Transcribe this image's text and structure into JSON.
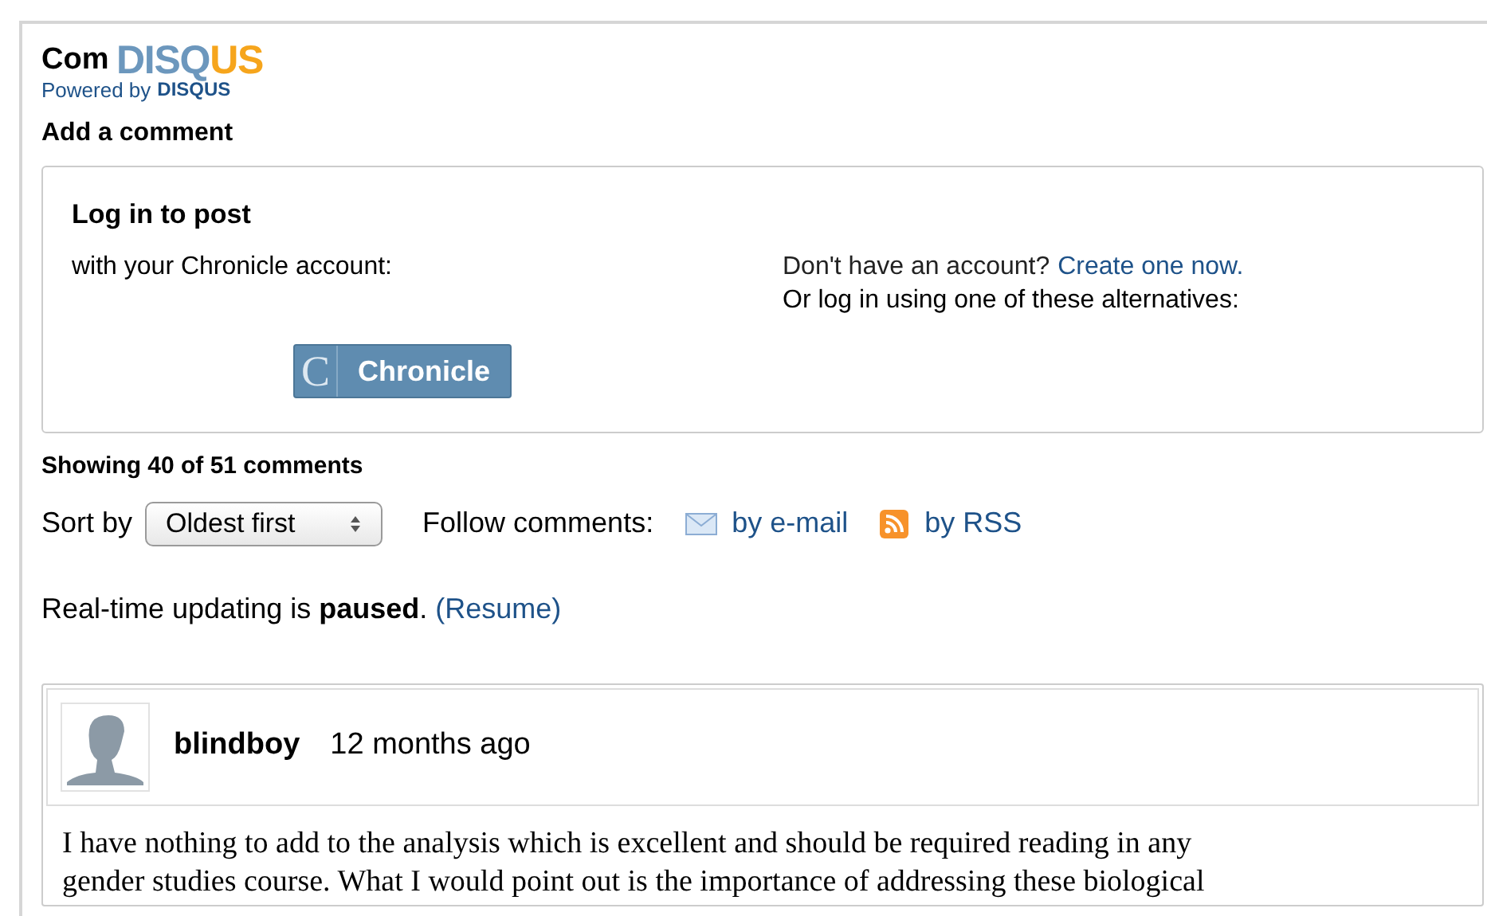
{
  "header": {
    "title": "Com",
    "logo": {
      "part_1": "DISQ",
      "part_2": "US"
    },
    "powered_by": "Powered by",
    "powered_brand": "DISQUS"
  },
  "add_comment": "Add a comment",
  "login": {
    "title": "Log in to post",
    "with_account": "with your Chronicle account:",
    "no_account": "Don't have an account?",
    "create_link": "Create one now.",
    "alternatives": "Or log in using one of these alternatives:",
    "button": {
      "letter": "C",
      "label": "Chronicle"
    }
  },
  "showing": "Showing 40 of 51 comments",
  "sort": {
    "label": "Sort by",
    "value": "Oldest first"
  },
  "follow": {
    "label": "Follow comments:",
    "email": "by e-mail",
    "rss": "by RSS"
  },
  "realtime": {
    "text": "Real-time updating is **paused**.",
    "link": "(Resume)"
  },
  "comments": [
    {
      "author": "blindboy",
      "time": "12 months ago",
      "lines": [
        "I have nothing to add to the analysis which is excellent and should be required reading in any",
        "gender studies course. What I would point out is the importance of addressing these biological"
      ]
    }
  ]
}
